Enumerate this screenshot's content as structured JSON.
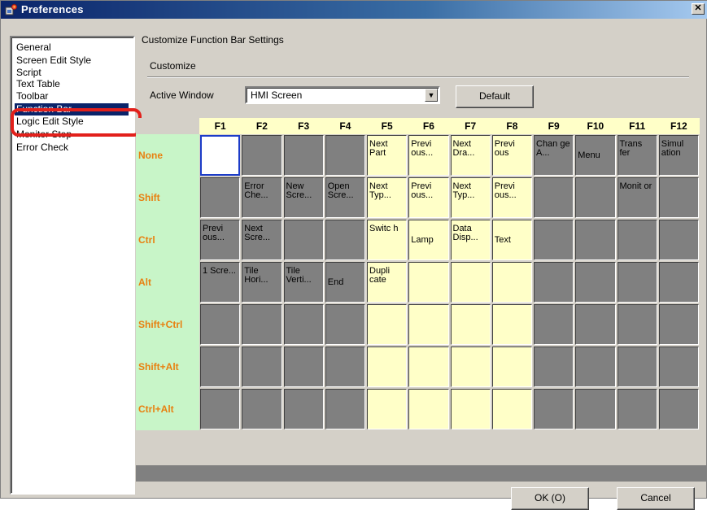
{
  "window": {
    "title": "Preferences",
    "close_glyph": "✕"
  },
  "sidebar": {
    "items": [
      {
        "label": "General",
        "selected": false
      },
      {
        "label": "Screen Edit Style",
        "selected": false
      },
      {
        "label": "Script",
        "selected": false
      },
      {
        "label": "Text Table",
        "selected": false
      },
      {
        "label": "Toolbar",
        "selected": false
      },
      {
        "label": "Function Bar",
        "selected": true
      },
      {
        "label": "Logic Edit Style",
        "selected": false
      },
      {
        "label": "Monitor Step",
        "selected": false
      },
      {
        "label": "Error Check",
        "selected": false
      }
    ]
  },
  "main": {
    "heading": "Customize Function Bar Settings",
    "group_label": "Customize",
    "active_window_label": "Active Window",
    "active_window_value": "HMI Screen",
    "default_button": "Default"
  },
  "grid": {
    "columns": [
      "F1",
      "F2",
      "F3",
      "F4",
      "F5",
      "F6",
      "F7",
      "F8",
      "F9",
      "F10",
      "F11",
      "F12"
    ],
    "rows": [
      {
        "label": "None",
        "cells": [
          {
            "t": "",
            "s": "empty"
          },
          {
            "t": "",
            "s": "gray"
          },
          {
            "t": "",
            "s": "gray"
          },
          {
            "t": "",
            "s": "gray"
          },
          {
            "t": "Next Part",
            "s": "yellow"
          },
          {
            "t": "Previ ous...",
            "s": "yellow"
          },
          {
            "t": "Next Dra...",
            "s": "yellow"
          },
          {
            "t": "Previ ous",
            "s": "yellow"
          },
          {
            "t": "Chan ge A...",
            "s": "gray"
          },
          {
            "t": "Menu",
            "s": "gray",
            "c": true
          },
          {
            "t": "Trans fer",
            "s": "gray"
          },
          {
            "t": "Simul ation",
            "s": "gray"
          }
        ]
      },
      {
        "label": "Shift",
        "cells": [
          {
            "t": "",
            "s": "gray"
          },
          {
            "t": "Error Che...",
            "s": "gray"
          },
          {
            "t": "New Scre...",
            "s": "gray"
          },
          {
            "t": "Open Scre...",
            "s": "gray"
          },
          {
            "t": "Next Typ...",
            "s": "yellow"
          },
          {
            "t": "Previ ous...",
            "s": "yellow"
          },
          {
            "t": "Next Typ...",
            "s": "yellow"
          },
          {
            "t": "Previ ous...",
            "s": "yellow"
          },
          {
            "t": "",
            "s": "gray"
          },
          {
            "t": "",
            "s": "gray"
          },
          {
            "t": "Monit or",
            "s": "gray"
          },
          {
            "t": "",
            "s": "gray"
          }
        ]
      },
      {
        "label": "Ctrl",
        "cells": [
          {
            "t": "Previ ous...",
            "s": "gray"
          },
          {
            "t": "Next Scre...",
            "s": "gray"
          },
          {
            "t": "",
            "s": "gray"
          },
          {
            "t": "",
            "s": "gray"
          },
          {
            "t": "Switc h",
            "s": "yellow"
          },
          {
            "t": "Lamp",
            "s": "yellow",
            "c": true
          },
          {
            "t": "Data Disp...",
            "s": "yellow"
          },
          {
            "t": "Text",
            "s": "yellow",
            "c": true
          },
          {
            "t": "",
            "s": "gray"
          },
          {
            "t": "",
            "s": "gray"
          },
          {
            "t": "",
            "s": "gray"
          },
          {
            "t": "",
            "s": "gray"
          }
        ]
      },
      {
        "label": "Alt",
        "cells": [
          {
            "t": "1 Scre...",
            "s": "gray"
          },
          {
            "t": "Tile Hori...",
            "s": "gray"
          },
          {
            "t": "Tile Verti...",
            "s": "gray"
          },
          {
            "t": "End",
            "s": "gray",
            "c": true
          },
          {
            "t": "Dupli cate",
            "s": "yellow"
          },
          {
            "t": "",
            "s": "yellow"
          },
          {
            "t": "",
            "s": "yellow"
          },
          {
            "t": "",
            "s": "yellow"
          },
          {
            "t": "",
            "s": "gray"
          },
          {
            "t": "",
            "s": "gray"
          },
          {
            "t": "",
            "s": "gray"
          },
          {
            "t": "",
            "s": "gray"
          }
        ]
      },
      {
        "label": "Shift+Ctrl",
        "cells": [
          {
            "t": "",
            "s": "gray"
          },
          {
            "t": "",
            "s": "gray"
          },
          {
            "t": "",
            "s": "gray"
          },
          {
            "t": "",
            "s": "gray"
          },
          {
            "t": "",
            "s": "yellow"
          },
          {
            "t": "",
            "s": "yellow"
          },
          {
            "t": "",
            "s": "yellow"
          },
          {
            "t": "",
            "s": "yellow"
          },
          {
            "t": "",
            "s": "gray"
          },
          {
            "t": "",
            "s": "gray"
          },
          {
            "t": "",
            "s": "gray"
          },
          {
            "t": "",
            "s": "gray"
          }
        ]
      },
      {
        "label": "Shift+Alt",
        "cells": [
          {
            "t": "",
            "s": "gray"
          },
          {
            "t": "",
            "s": "gray"
          },
          {
            "t": "",
            "s": "gray"
          },
          {
            "t": "",
            "s": "gray"
          },
          {
            "t": "",
            "s": "yellow"
          },
          {
            "t": "",
            "s": "yellow"
          },
          {
            "t": "",
            "s": "yellow"
          },
          {
            "t": "",
            "s": "yellow"
          },
          {
            "t": "",
            "s": "gray"
          },
          {
            "t": "",
            "s": "gray"
          },
          {
            "t": "",
            "s": "gray"
          },
          {
            "t": "",
            "s": "gray"
          }
        ]
      },
      {
        "label": "Ctrl+Alt",
        "cells": [
          {
            "t": "",
            "s": "gray"
          },
          {
            "t": "",
            "s": "gray"
          },
          {
            "t": "",
            "s": "gray"
          },
          {
            "t": "",
            "s": "gray"
          },
          {
            "t": "",
            "s": "yellow"
          },
          {
            "t": "",
            "s": "yellow"
          },
          {
            "t": "",
            "s": "yellow"
          },
          {
            "t": "",
            "s": "yellow"
          },
          {
            "t": "",
            "s": "gray"
          },
          {
            "t": "",
            "s": "gray"
          },
          {
            "t": "",
            "s": "gray"
          },
          {
            "t": "",
            "s": "gray"
          }
        ]
      }
    ]
  },
  "footer": {
    "ok_button": "OK (O)",
    "cancel_button": "Cancel"
  },
  "colors": {
    "row_label_bg": "#c8f5c8",
    "row_label_text": "#e88010",
    "header_bg": "#ffffc8",
    "assigned_cell": "#ffffc8",
    "unassigned_cell": "#808080",
    "highlight_ring": "#e2201b",
    "selection": "#0a246a"
  }
}
